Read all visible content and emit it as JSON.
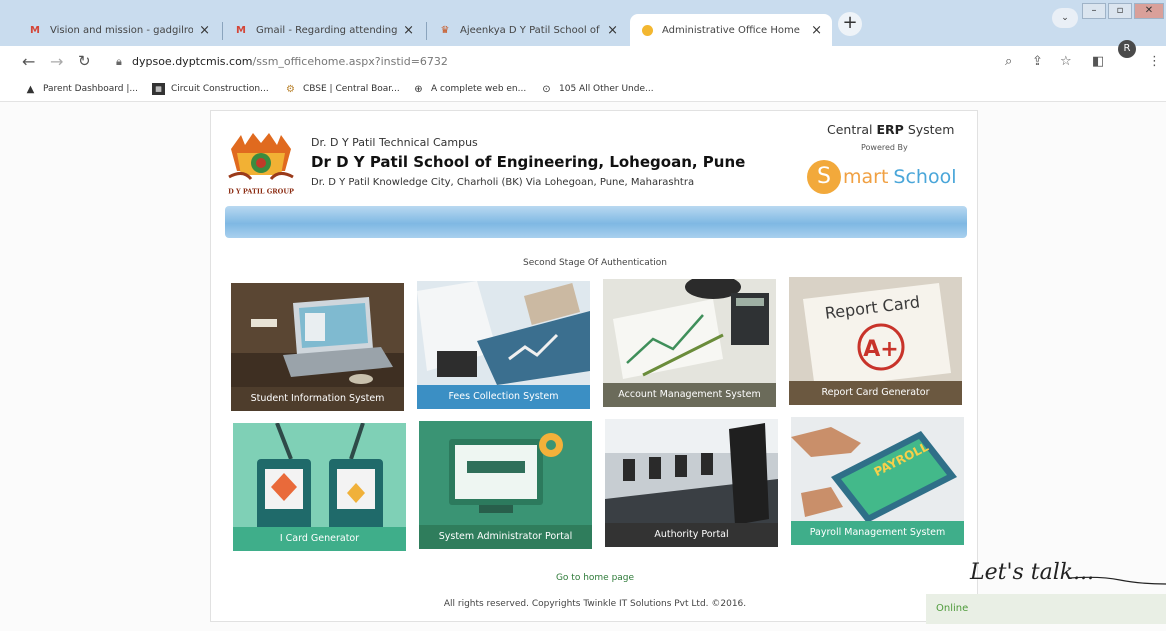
{
  "browser": {
    "tabs": [
      {
        "title": "Vision and mission - gadgilrohin",
        "icon": "gmail-icon"
      },
      {
        "title": "Gmail - Regarding attending the",
        "icon": "gmail-icon"
      },
      {
        "title": "Ajeenkya D Y Patil School of Eng",
        "icon": "school-crest-icon"
      },
      {
        "title": "Administrative Office Home",
        "icon": "loading-icon"
      }
    ],
    "url_host": "dypsoe.dyptcmis.com",
    "url_path": "/ssm_officehome.aspx?instid=6732",
    "profile_initial": "R",
    "bookmarks": [
      {
        "label": "Parent Dashboard |...",
        "icon": "dashboard-icon"
      },
      {
        "label": "Circuit Construction...",
        "icon": "phet-icon"
      },
      {
        "label": "CBSE | Central Boar...",
        "icon": "cbse-icon"
      },
      {
        "label": "A complete web en...",
        "icon": "globe-icon"
      },
      {
        "label": "105 All Other Unde...",
        "icon": "link-icon"
      }
    ]
  },
  "header": {
    "campus": "Dr. D Y Patil Technical Campus",
    "school_name": "Dr D Y Patil School of Engineering, Lohegoan, Pune",
    "address": "Dr. D Y Patil Knowledge City, Charholi (BK) Via Lohegoan, Pune, Maharashtra",
    "logo_caption": "D Y PATIL GROUP",
    "erp_prefix": "Central",
    "erp_bold": "ERP",
    "erp_suffix": "System",
    "powered_by": "Powered By",
    "brand_letter": "S",
    "brand_part1": "mart",
    "brand_part2": "School"
  },
  "main": {
    "stage_label": "Second Stage Of Authentication",
    "tiles": [
      {
        "label": "Student Information System",
        "caption_color": "#4e3d2c"
      },
      {
        "label": "Fees Collection System",
        "caption_color": "#3b8fc4"
      },
      {
        "label": "Account Management System",
        "caption_color": "#6b6b5a"
      },
      {
        "label": "Report Card Generator",
        "caption_color": "#6b5840"
      },
      {
        "label": "I Card Generator",
        "caption_color": "#3fae8a"
      },
      {
        "label": "System Administrator Portal",
        "caption_color": "#2f7d5c"
      },
      {
        "label": "Authority Portal",
        "caption_color": "#333333"
      },
      {
        "label": "Payroll Management System",
        "caption_color": "#3fae8a"
      }
    ],
    "report_card_text": "Report Card",
    "report_card_grade": "A+",
    "payroll_text": "PAYROLL",
    "home_link": "Go to home page",
    "copyright": "All rights reserved. Copyrights Twinkle IT Solutions Pvt Ltd. ©2016."
  },
  "chat": {
    "title": "Let's talk...",
    "status": "Online"
  }
}
